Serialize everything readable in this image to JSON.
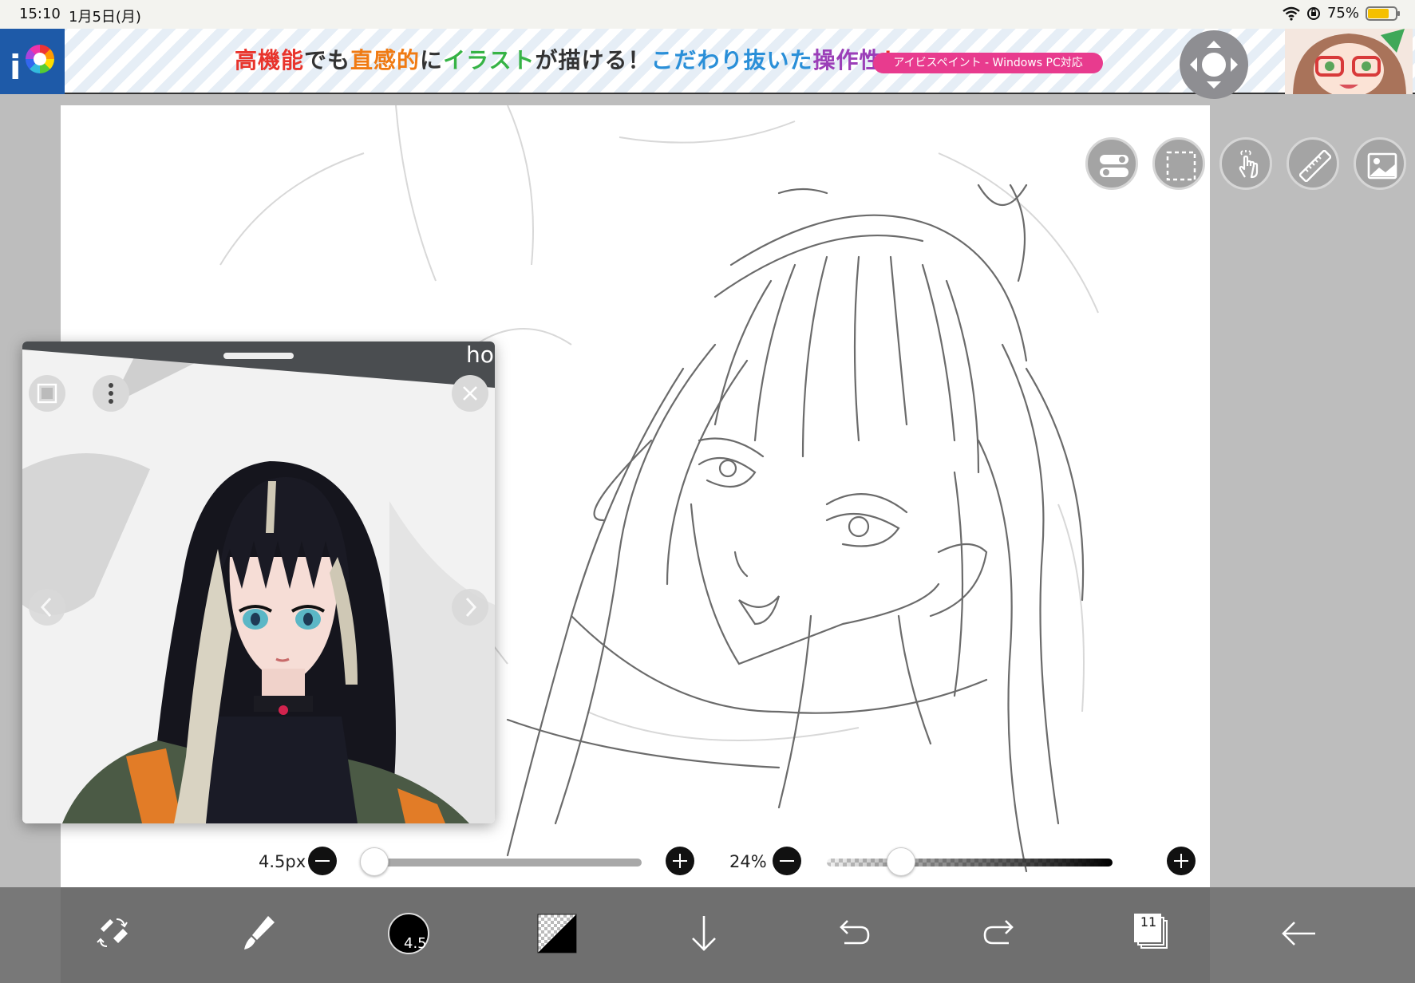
{
  "status_bar": {
    "time": "15:10",
    "date": "1月5日(月)",
    "battery": "75%",
    "battery_level": 0.75
  },
  "banner": {
    "headline": [
      "高機能",
      "でも",
      "直感的",
      "に",
      "イラスト",
      "が描ける！",
      "こだわり抜いた",
      "操作性",
      "！"
    ],
    "pill_text": "アイビスペイント - Windows PC対応"
  },
  "toolbar_top": {
    "icons": [
      "layer-toggle-icon",
      "selection-icon",
      "touch-gesture-icon",
      "ruler-icon",
      "image-icon"
    ]
  },
  "reference_window": {
    "title_fragment": "ho"
  },
  "sliders": {
    "size_label": "4.5px",
    "size_value": 0.01,
    "opacity_label": "24%",
    "opacity_value": 0.24
  },
  "bottom_toolbar": {
    "brush_size": "4.5",
    "layer_count": "11"
  },
  "colors": {
    "canvas": "#ffffff",
    "toolbar": "#6f6f6f",
    "side": "#bdbdbd"
  }
}
